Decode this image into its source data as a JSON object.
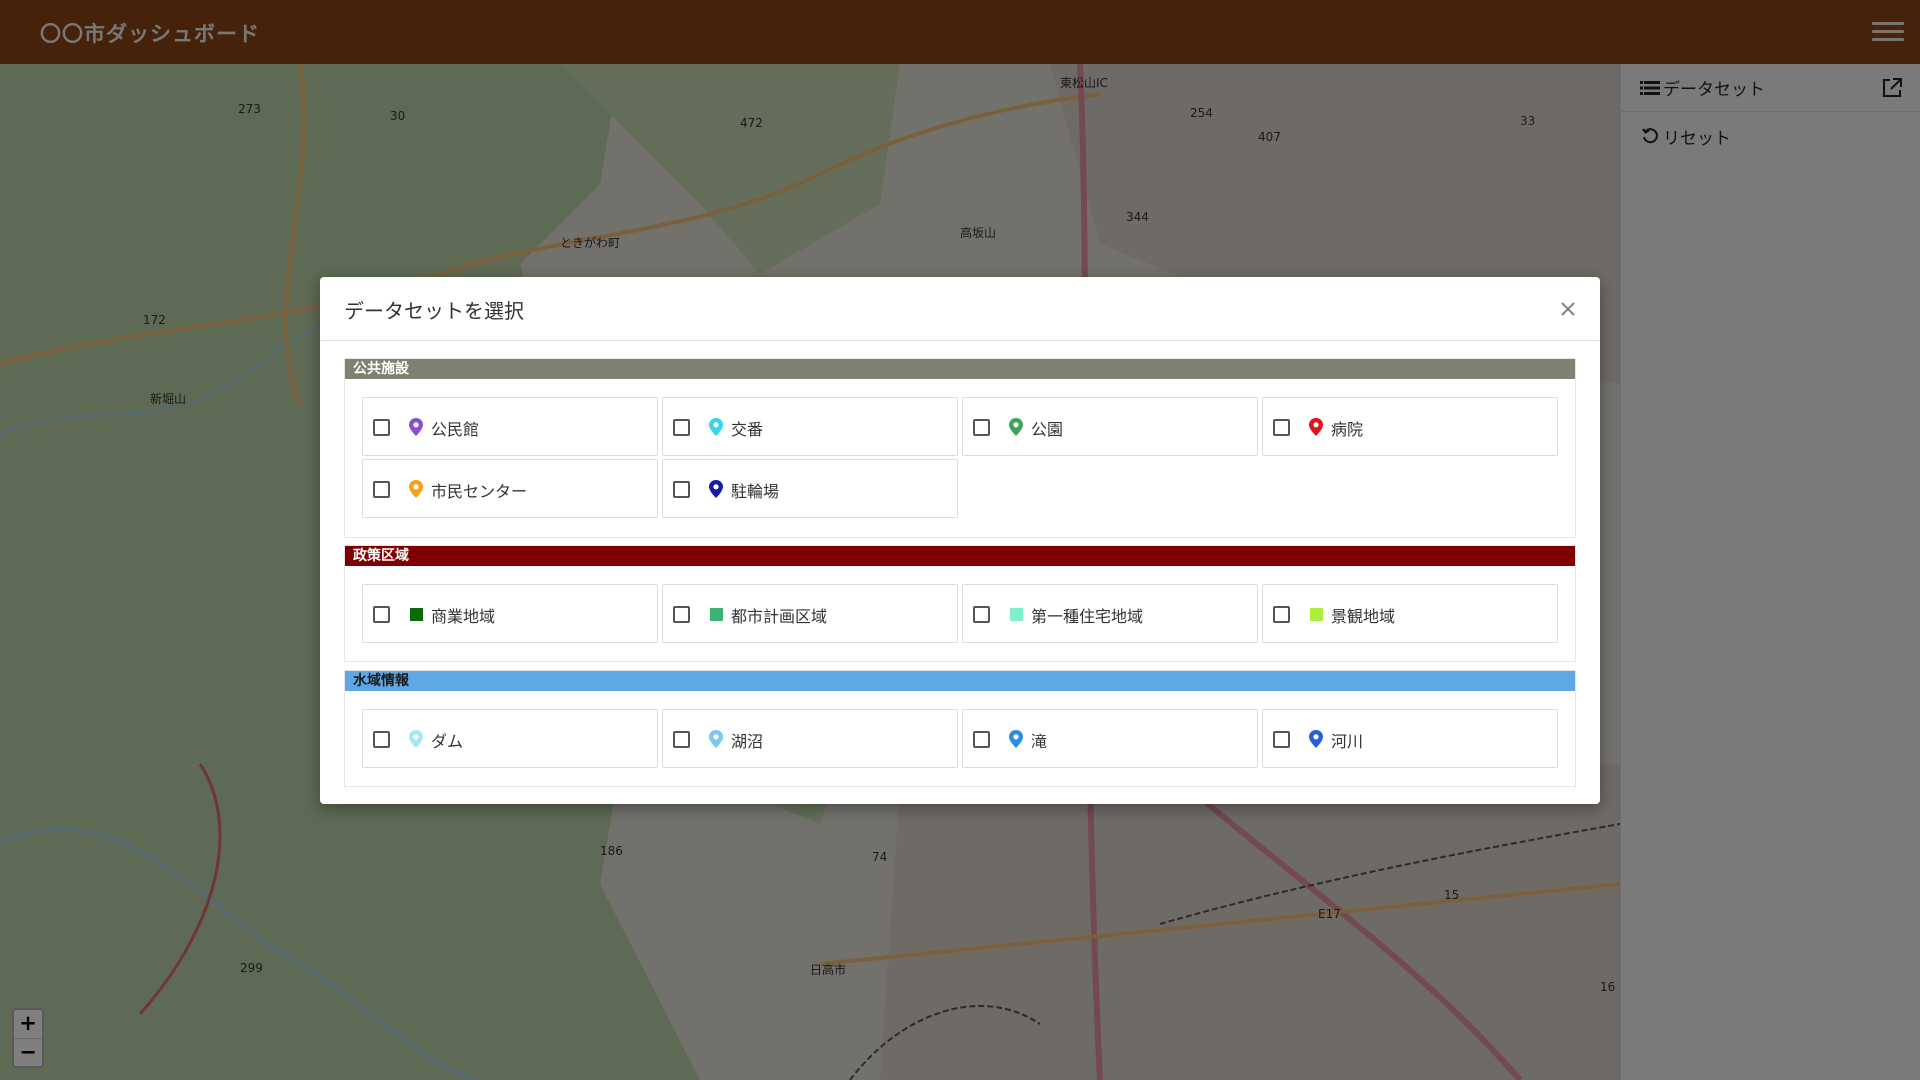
{
  "header": {
    "title": "〇〇市ダッシュボード"
  },
  "sidebar": {
    "dataset_label": "データセット",
    "reset_label": "リセット"
  },
  "map": {
    "labels": [
      "ときがわ町",
      "日高市",
      "新堀山",
      "東松山IC",
      "高坂山",
      "472",
      "30",
      "273",
      "172",
      "254",
      "407",
      "344",
      "33",
      "299",
      "186",
      "74",
      "E17",
      "15",
      "16"
    ],
    "zoom_in": "+",
    "zoom_out": "−"
  },
  "modal": {
    "title": "データセットを選択",
    "sections": [
      {
        "name": "公共施設",
        "color": "#808073",
        "items": [
          {
            "label": "公民館",
            "icon": "pin-icon",
            "color": "#8a4fd1"
          },
          {
            "label": "交番",
            "icon": "pin-icon",
            "color": "#3bd4e6"
          },
          {
            "label": "公園",
            "icon": "pin-icon",
            "color": "#3fa35a"
          },
          {
            "label": "病院",
            "icon": "pin-icon",
            "color": "#e3141b"
          },
          {
            "label": "市民センター",
            "icon": "pin-icon",
            "color": "#f5a21a"
          },
          {
            "label": "駐輪場",
            "icon": "pin-icon",
            "color": "#1a1aa8"
          }
        ]
      },
      {
        "name": "政策区域",
        "color": "#800000",
        "items": [
          {
            "label": "商業地域",
            "icon": "square-icon",
            "color": "#0a6b0a"
          },
          {
            "label": "都市計画区域",
            "icon": "square-icon",
            "color": "#3cb371"
          },
          {
            "label": "第一種住宅地域",
            "icon": "square-icon",
            "color": "#80f0c8"
          },
          {
            "label": "景観地域",
            "icon": "square-icon",
            "color": "#a8f03c"
          }
        ]
      },
      {
        "name": "水域情報",
        "color": "#5ea8e6",
        "items": [
          {
            "label": "ダム",
            "icon": "pin-icon",
            "color": "#a8e6f5"
          },
          {
            "label": "湖沼",
            "icon": "pin-icon",
            "color": "#7ec8ef"
          },
          {
            "label": "滝",
            "icon": "pin-icon",
            "color": "#2f8de0"
          },
          {
            "label": "河川",
            "icon": "pin-icon",
            "color": "#2a5fd6"
          }
        ]
      }
    ]
  }
}
